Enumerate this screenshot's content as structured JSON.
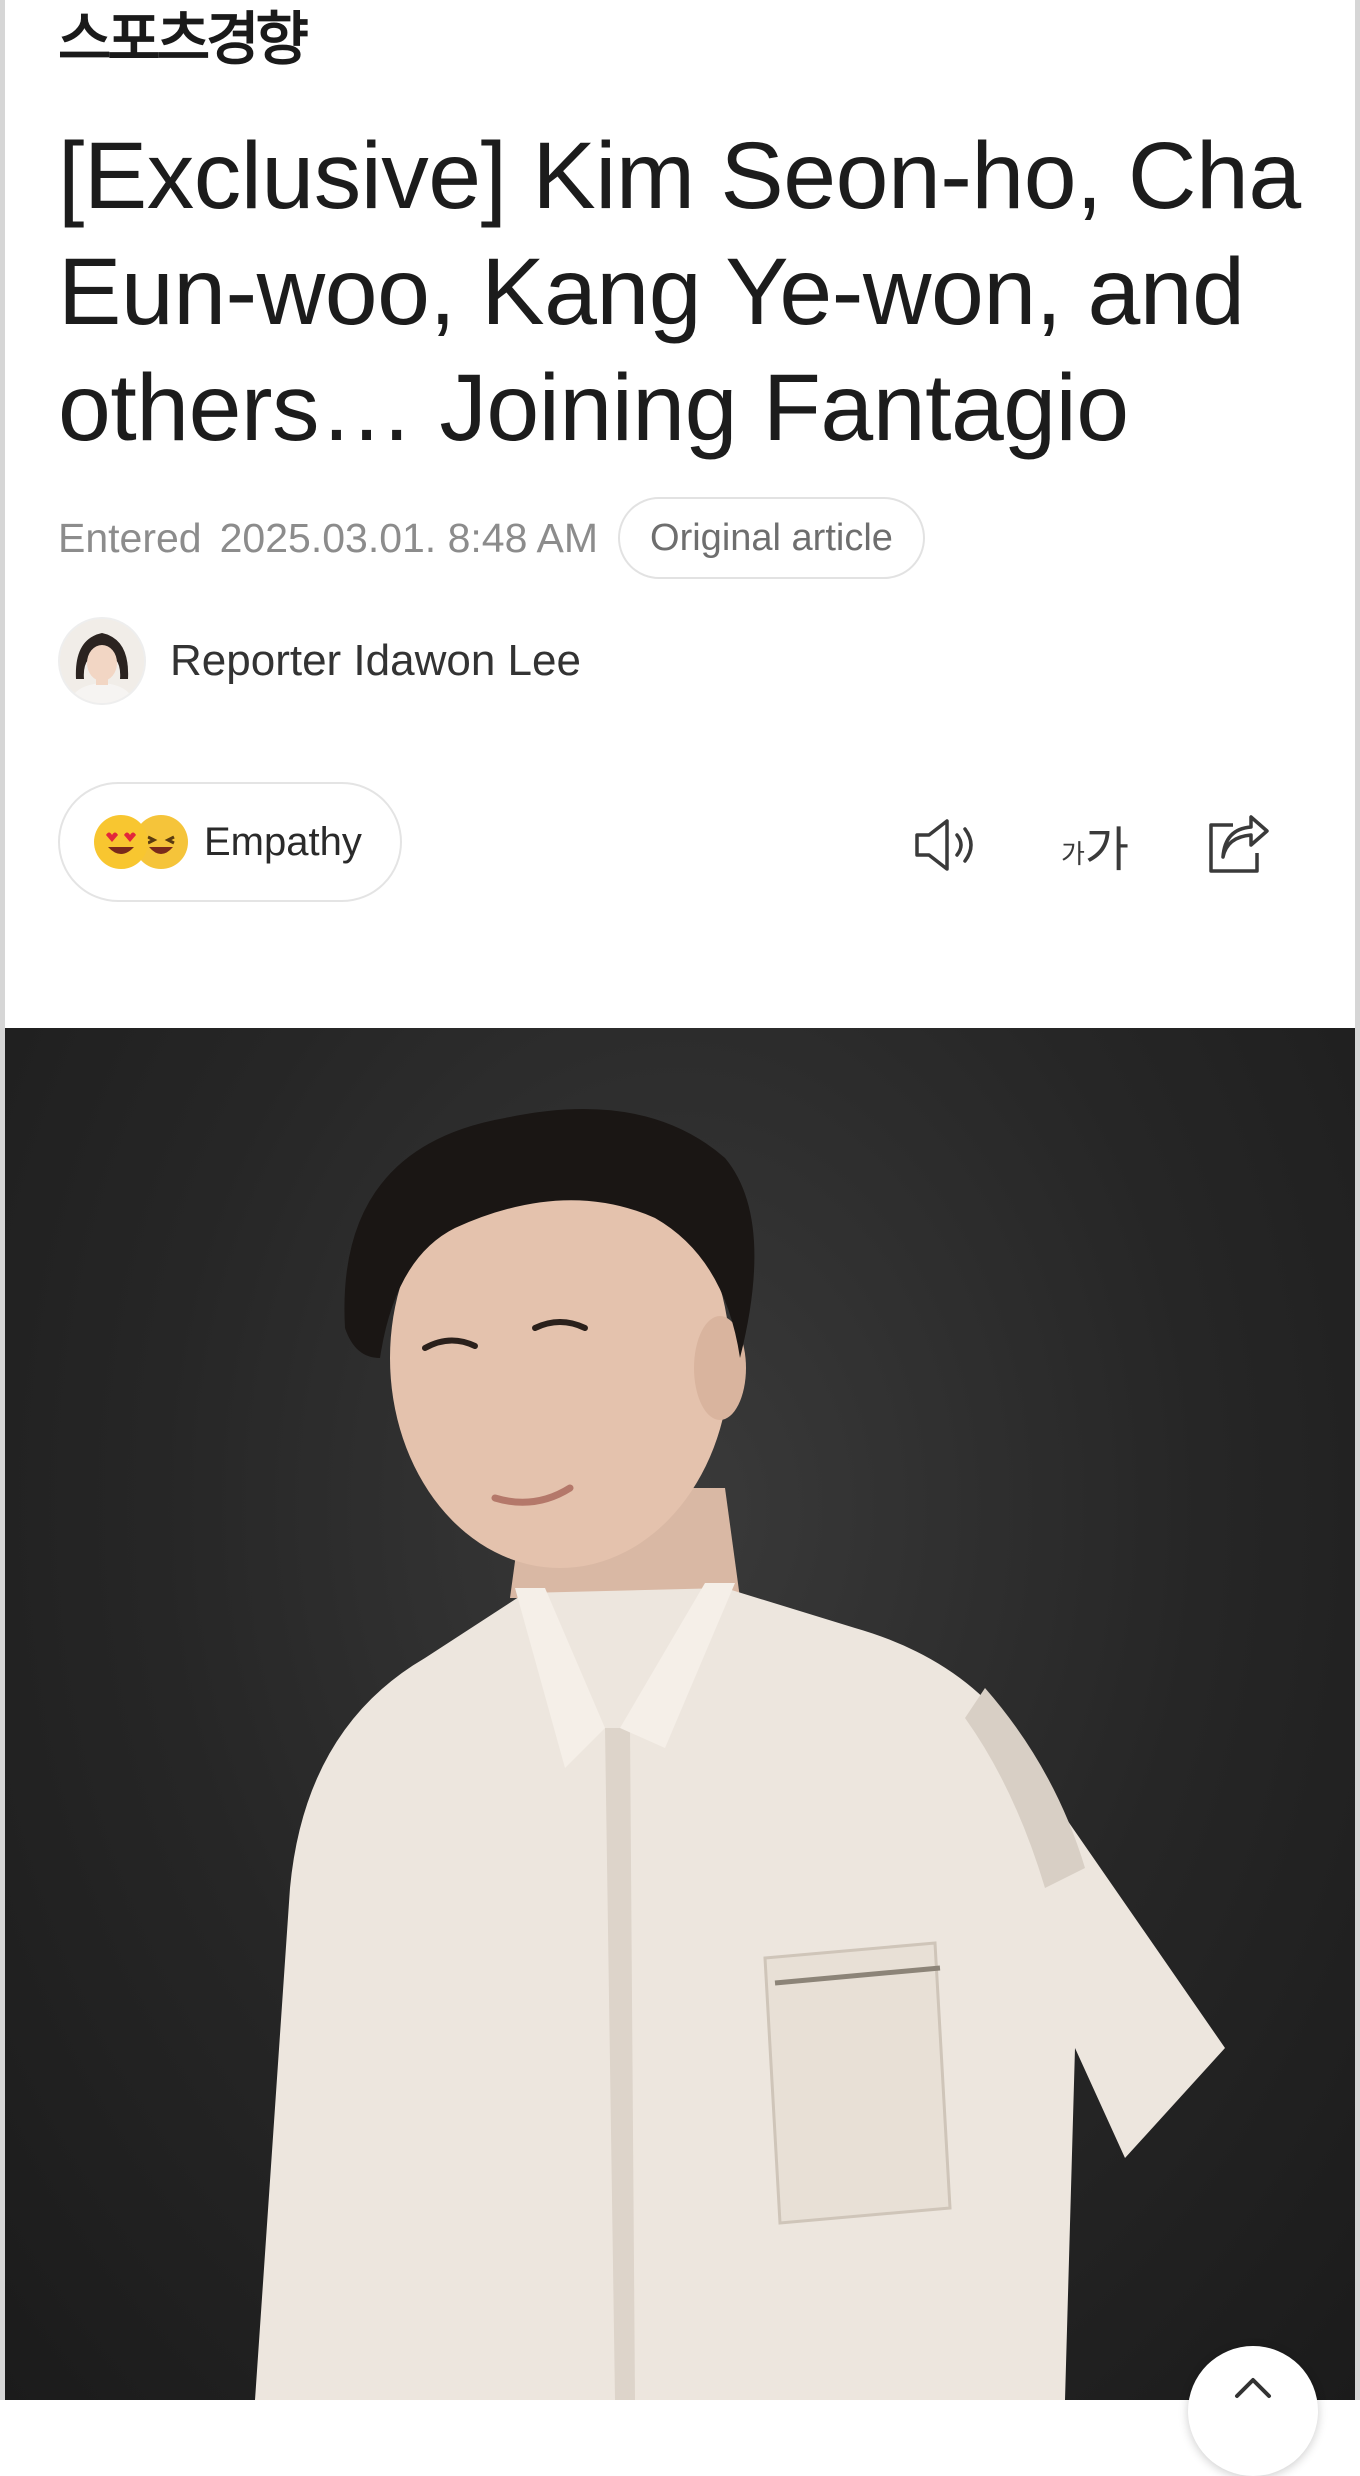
{
  "header": {
    "masthead": "스포츠경향"
  },
  "article": {
    "title": "[Exclusive] Kim Seon-ho, Cha Eun-woo, Kang Ye-won, and others… Joining Fantagio",
    "entered_label": "Entered",
    "entered_date": "2025.03.01. 8:48 AM",
    "original_article_label": "Original article",
    "reporter": "Reporter Idawon Lee"
  },
  "toolbar": {
    "empathy_label": "Empathy",
    "font_size_small": "가",
    "font_size_big": "가",
    "icons": [
      "speaker-icon",
      "font-size-icon",
      "share-icon"
    ]
  },
  "colors": {
    "meta_text": "#8c8c8c",
    "photo_bg": "#262626",
    "emoji": "#f8c630"
  }
}
